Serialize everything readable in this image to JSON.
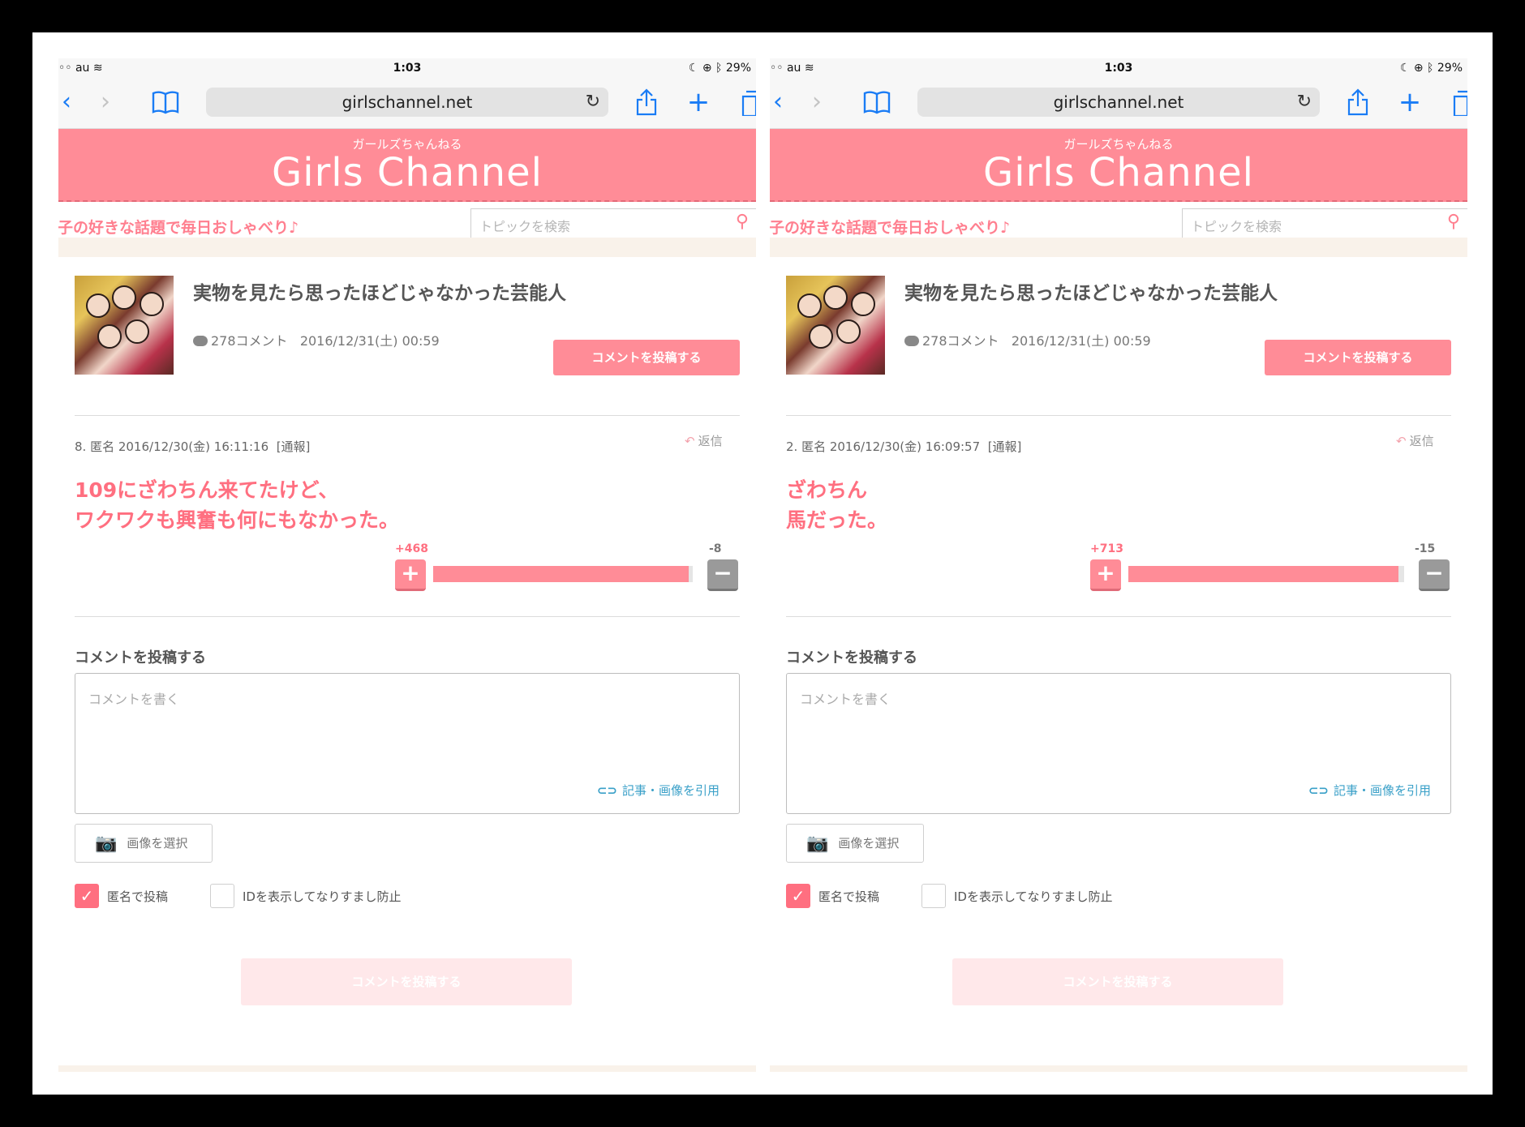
{
  "browser": {
    "carrier": "au",
    "time": "1:03",
    "battery": "29%",
    "url": "girlschannel.net"
  },
  "site": {
    "logo_sub": "ガールズちゃんねる",
    "logo_main": "Girls Channel",
    "tagline": "女子の好きな話題で毎日おしゃべり♪",
    "search_placeholder": "トピックを検索"
  },
  "topic": {
    "title": "実物を見たら思ったほどじゃなかった芸能人",
    "comment_count": "278コメント",
    "date": "2016/12/31(土) 00:59",
    "post_button": "コメントを投稿する"
  },
  "panels": [
    {
      "comment_meta": "8. 匿名 2016/12/30(金) 16:11:16",
      "report": "[通報]",
      "reply": "返信",
      "body_line1": "109にざわちん来てたけど、",
      "body_line2": "ワクワクも興奮も何にもなかった。",
      "plus": "+468",
      "minus": "-8",
      "plus_fraction": 0.983
    },
    {
      "comment_meta": "2. 匿名 2016/12/30(金) 16:09:57",
      "report": "[通報]",
      "reply": "返信",
      "body_line1": "ざわちん",
      "body_line2": "馬だった。",
      "plus": "+713",
      "minus": "-15",
      "plus_fraction": 0.979
    }
  ],
  "form": {
    "title": "コメントを投稿する",
    "placeholder": "コメントを書く",
    "quote_link": "記事・画像を引用",
    "image_button": "画像を選択",
    "anon_label": "匿名で投稿",
    "id_label": "IDを表示してなりすまし防止",
    "submit": "コメントを投稿する"
  },
  "colors": {
    "brand_pink": "#ff8c97",
    "comment_text": "#ff6f80",
    "ios_blue": "#1a7cf5"
  }
}
